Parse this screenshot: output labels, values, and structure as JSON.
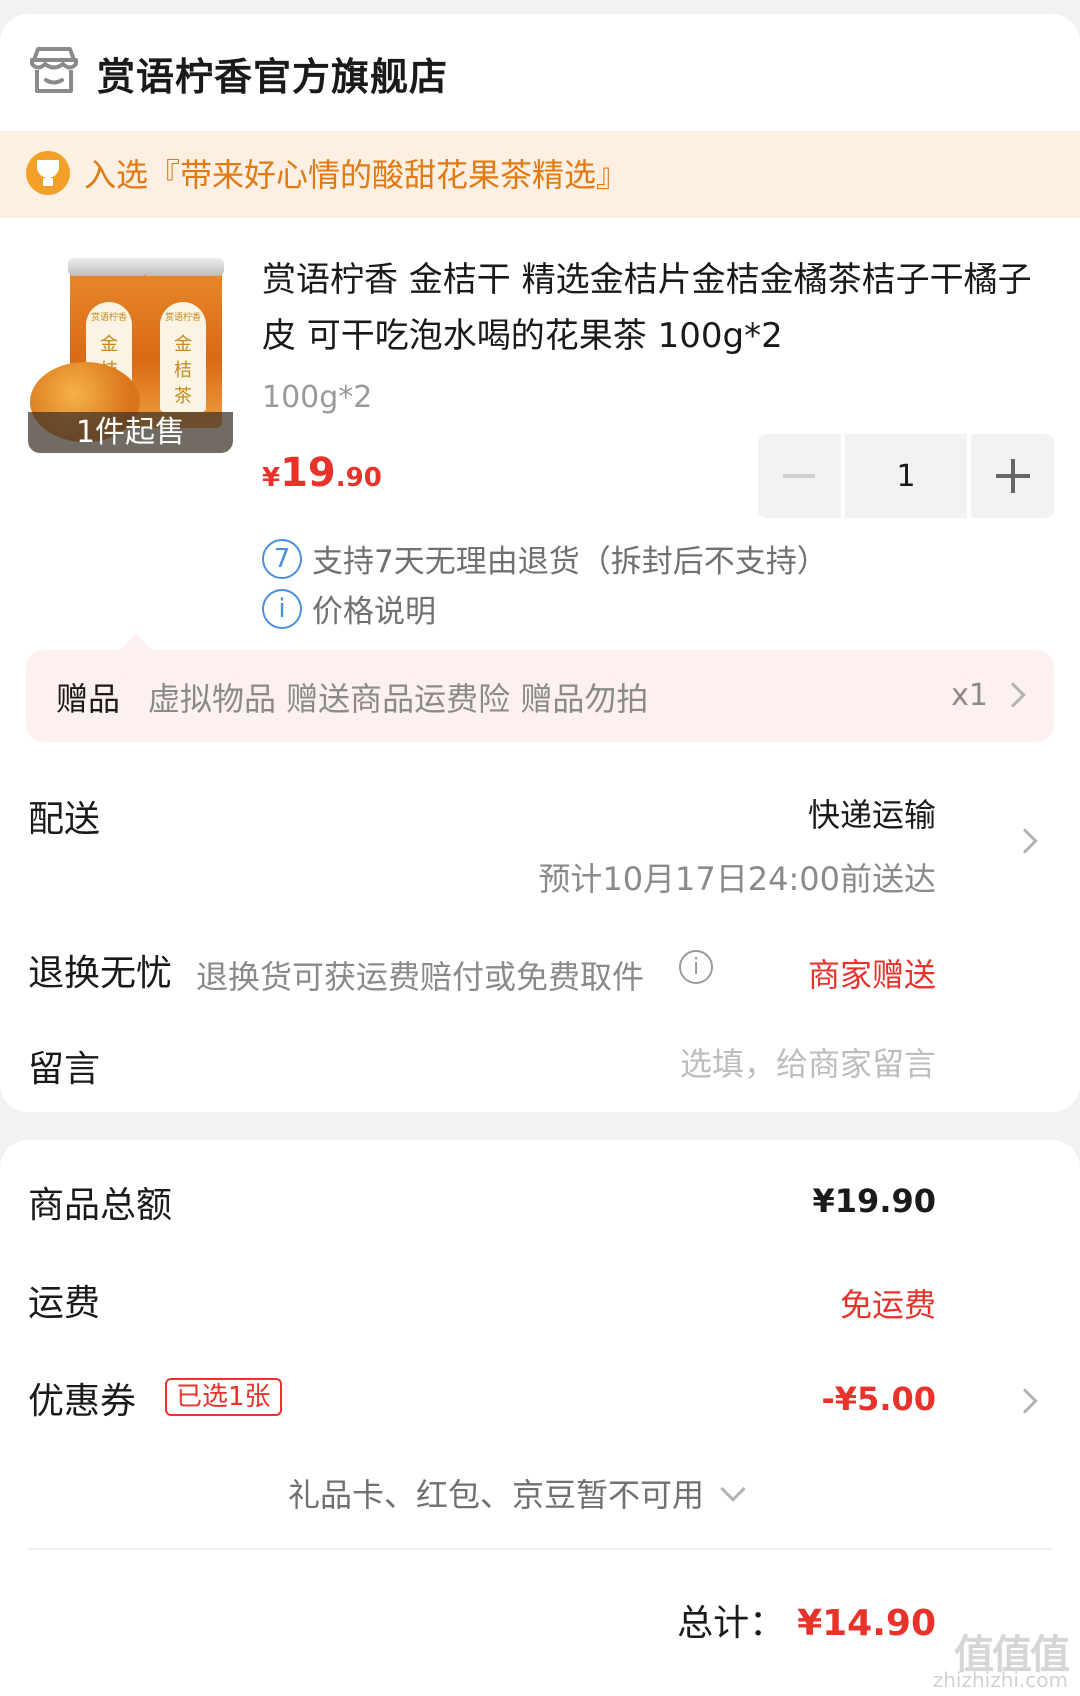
{
  "store": {
    "name": "赏语柠香官方旗舰店",
    "icon": "store-icon",
    "badge": "入选『带来好心情的酸甜花果茶精选』"
  },
  "product": {
    "title": "赏语柠香 金桔干 精选金桔片金桔金橘茶桔子干橘子皮 可干吃泡水喝的花果茶 100g*2",
    "spec": "100g*2",
    "min_sale": "1件起售",
    "jar_brand": "赏语柠香",
    "jar_labels": [
      "金桔片",
      "金桔茶"
    ],
    "price_currency": "¥",
    "price_int": "19",
    "price_dec": ".90",
    "quantity": "1"
  },
  "services": [
    {
      "icon_text": "7",
      "text": "支持7天无理由退货（拆封后不支持）"
    },
    {
      "icon_text": "i",
      "text": "价格说明"
    }
  ],
  "gift": {
    "tag": "赠品",
    "desc": "虚拟物品 赠送商品运费险 赠品勿拍",
    "qty": "x1"
  },
  "shipping": {
    "label": "配送",
    "method": "快递运输",
    "eta": "预计10月17日24:00前送达"
  },
  "returns": {
    "label": "退换无忧",
    "desc": "退换货可获运费赔付或免费取件",
    "value": "商家赠送"
  },
  "message": {
    "label": "留言",
    "placeholder": "选填，给商家留言"
  },
  "summary": {
    "goods_label": "商品总额",
    "goods_value": "¥19.90",
    "fee_label": "运费",
    "fee_value": "免运费",
    "coupon_label": "优惠券",
    "coupon_tag": "已选1张",
    "coupon_value": "-¥5.00",
    "unavailable": "礼品卡、红包、京豆暂不可用",
    "total_label": "总计：",
    "total_value": "¥14.90"
  },
  "watermark": {
    "cn": "值值值",
    "url": "zhizhizhi.com"
  },
  "colors": {
    "accent_red": "#e8322a",
    "badge_orange": "#e07a14",
    "badge_bg": "#fdf0e2",
    "info_blue": "#4a8fde",
    "gift_bg": "#fdf1f0"
  }
}
